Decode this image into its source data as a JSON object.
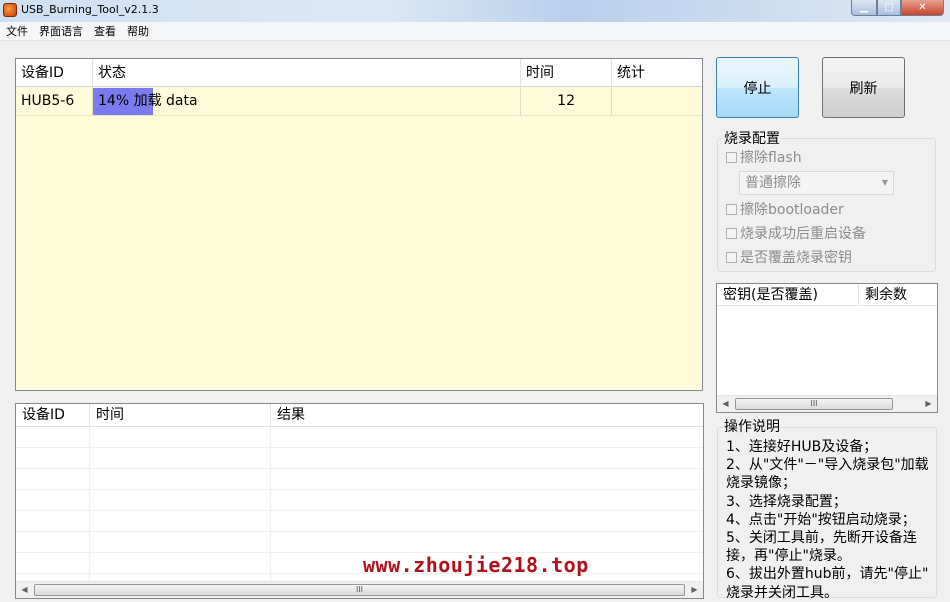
{
  "window": {
    "title": "USB_Burning_Tool_v2.1.3",
    "controls": {
      "minimize": "▁",
      "maximize": "□",
      "close": "✕"
    }
  },
  "menu": [
    "文件",
    "界面语言",
    "查看",
    "帮助"
  ],
  "device_table": {
    "columns": [
      "设备ID",
      "状态",
      "时间",
      "统计"
    ],
    "rows": [
      {
        "device_id": "HUB5-6",
        "status": "14% 加载 data",
        "progress": 0.14,
        "time": "12",
        "stats": ""
      }
    ]
  },
  "buttons": {
    "stop": "停止",
    "refresh": "刷新"
  },
  "burn_config": {
    "title": "烧录配置",
    "erase_flash": "擦除flash",
    "erase_mode": "普通擦除",
    "erase_bootloader": "擦除bootloader",
    "reboot_after": "烧录成功后重启设备",
    "overwrite_key": "是否覆盖烧录密钥"
  },
  "key_table": {
    "columns": [
      "密钥(是否覆盖)",
      "剩余数"
    ],
    "scroll_thumb": "III"
  },
  "instructions": {
    "title": "操作说明",
    "lines": [
      "1、连接好HUB及设备；",
      "2、从\"文件\"－\"导入烧录包\"加载",
      "烧录镜像；",
      "3、选择烧录配置；",
      "4、点击\"开始\"按钮启动烧录；",
      "5、关闭工具前，先断开设备连",
      "接，再\"停止\"烧录。",
      "6、拔出外置hub前，请先\"停止\"",
      "烧录并关闭工具。"
    ]
  },
  "results_table": {
    "columns": [
      "设备ID",
      "时间",
      "结果"
    ],
    "scroll_thumb": "III"
  },
  "watermark": "www.zhoujie218.top",
  "colors": {
    "accent": "#7b7bf0",
    "table_bg": "#fefbdb",
    "watermark": "#b0101a"
  }
}
